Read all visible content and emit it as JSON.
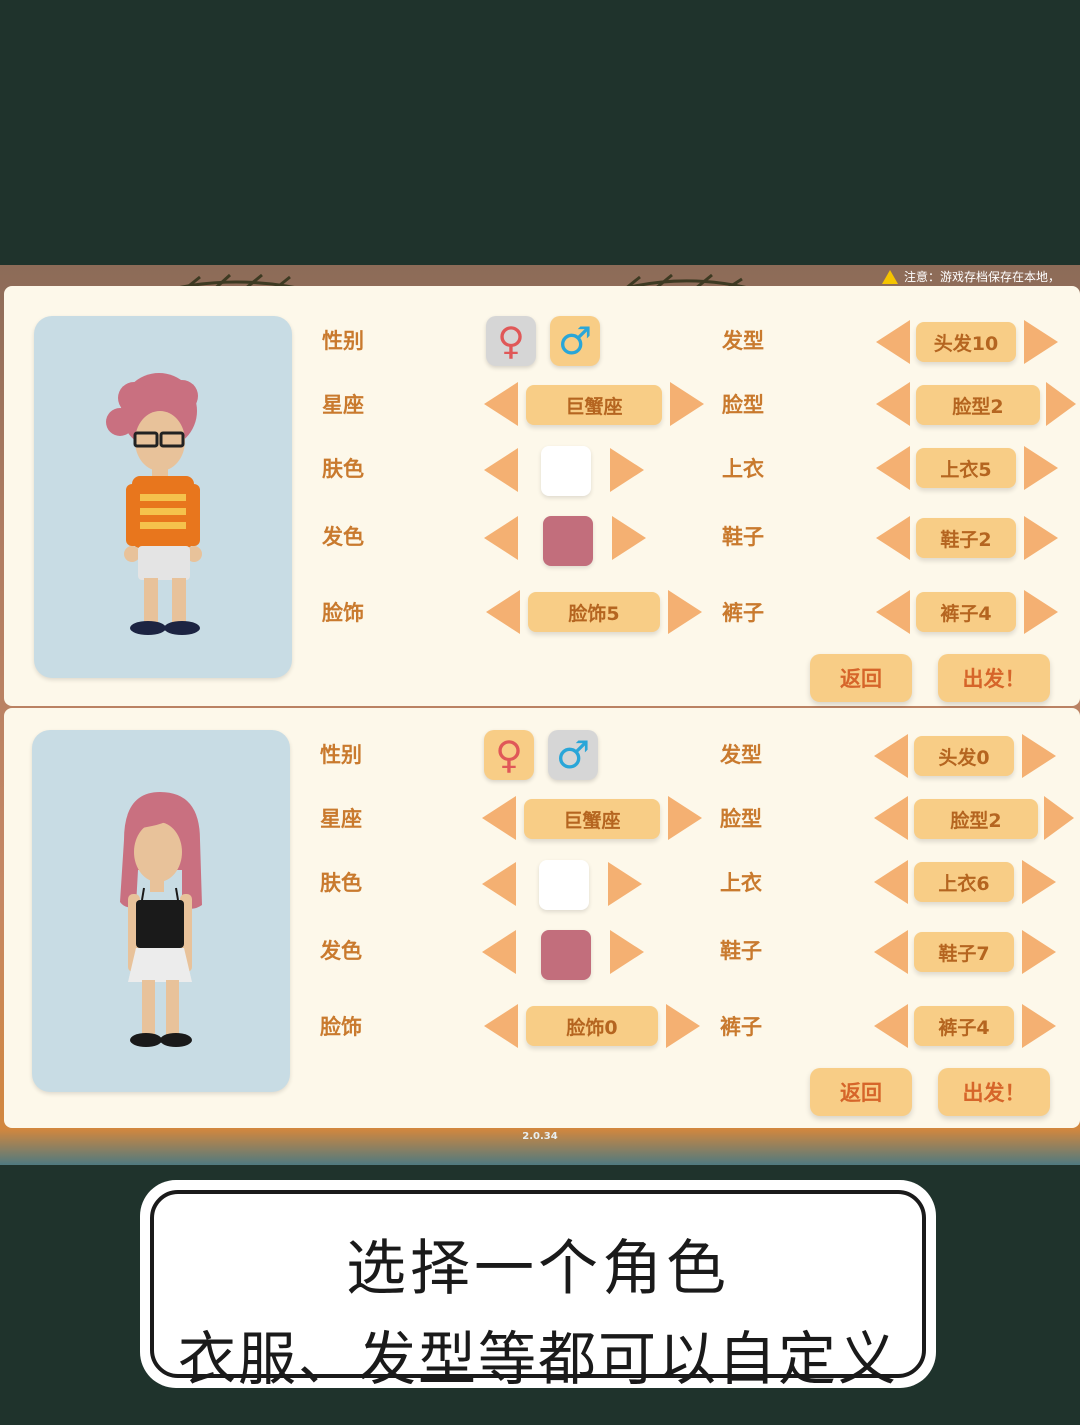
{
  "notice": "注意：游戏存档保存在本地，",
  "version": "2.0.34",
  "labels": {
    "gender": "性别",
    "zodiac": "星座",
    "skin": "肤色",
    "hair_color": "发色",
    "face_acc": "脸饰",
    "hair": "发型",
    "face": "脸型",
    "top": "上衣",
    "shoes": "鞋子",
    "pants": "裤子"
  },
  "gender_icons": {
    "female": "♀",
    "male": "♂"
  },
  "characters": [
    {
      "gender_selected": "male",
      "zodiac": "巨蟹座",
      "skin_color": "#ffffff",
      "hair_color": "#c26e7c",
      "face_acc": "脸饰5",
      "hair": "头发10",
      "face": "脸型2",
      "top": "上衣5",
      "shoes": "鞋子2",
      "pants": "裤子4"
    },
    {
      "gender_selected": "female",
      "zodiac": "巨蟹座",
      "skin_color": "#ffffff",
      "hair_color": "#c26e7c",
      "face_acc": "脸饰0",
      "hair": "头发0",
      "face": "脸型2",
      "top": "上衣6",
      "shoes": "鞋子7",
      "pants": "裤子4"
    }
  ],
  "buttons": {
    "back": "返回",
    "go": "出发！"
  },
  "caption": {
    "line1": "选择一个角色",
    "line2": "衣服、发型等都可以自定义"
  },
  "colors": {
    "arrow": "#f4b072",
    "pill": "#f8cd86",
    "label": "#c97a2e",
    "panel": "#fdf8ea",
    "background": "#1f332c"
  }
}
